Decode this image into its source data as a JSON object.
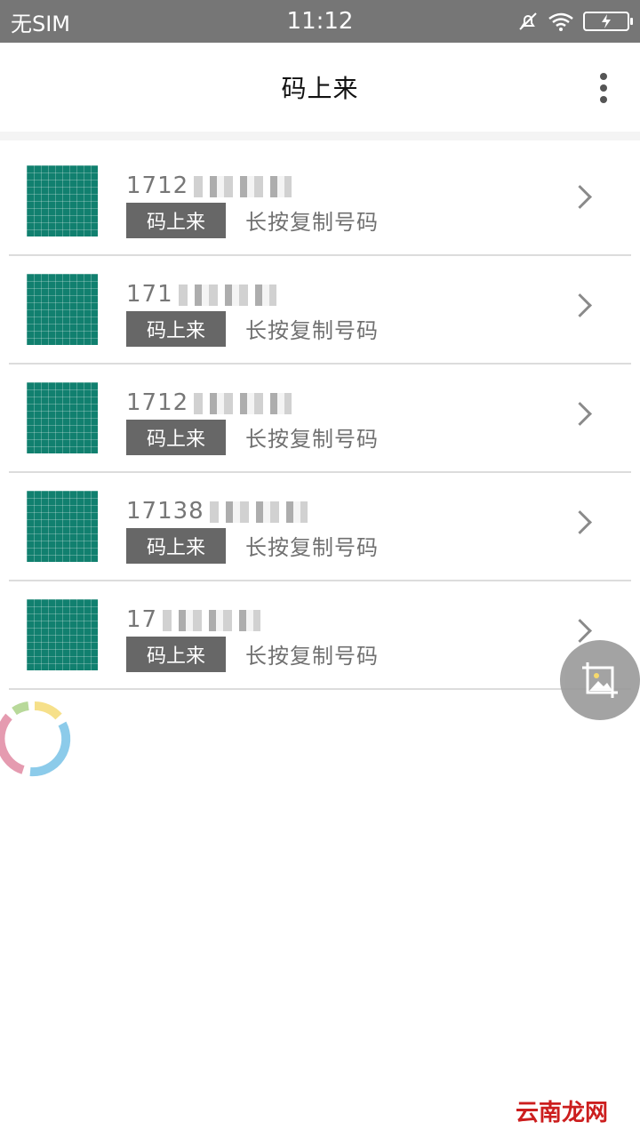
{
  "status_bar": {
    "carrier": "无SIM",
    "time": "11:12",
    "icons": [
      "mute-icon",
      "wifi-icon",
      "battery-charging-icon"
    ]
  },
  "app_bar": {
    "title": "码上来",
    "menu_icon": "overflow-menu-icon"
  },
  "list": {
    "items": [
      {
        "number": "1712",
        "tag": "码上来",
        "hint": "长按复制号码"
      },
      {
        "number": "171",
        "tag": "码上来",
        "hint": "长按复制号码"
      },
      {
        "number": "1712",
        "tag": "码上来",
        "hint": "长按复制号码"
      },
      {
        "number": "17138",
        "tag": "码上来",
        "hint": "长按复制号码"
      },
      {
        "number": "17",
        "tag": "码上来",
        "hint": "长按复制号码"
      }
    ]
  },
  "fab": {
    "icon": "image-crop-icon"
  },
  "watermark": {
    "text": "云南龙网"
  },
  "colors": {
    "status_bar": "#767676",
    "thumbnail": "#11806f",
    "tag_bg": "#676767",
    "watermark": "#cc1e1e"
  }
}
